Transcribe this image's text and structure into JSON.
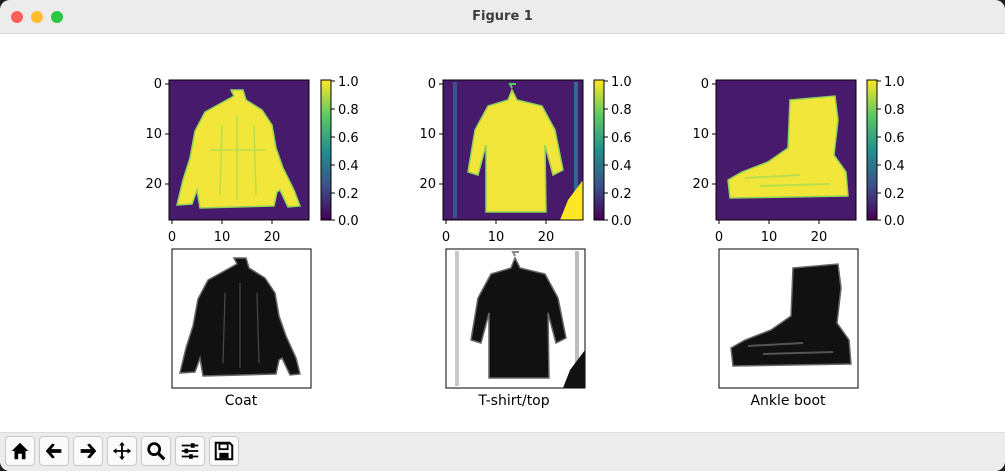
{
  "window": {
    "title": "Figure 1"
  },
  "figure": {
    "heatmaps": [
      {
        "name": "coat",
        "xticks": [
          "0",
          "10",
          "20"
        ],
        "yticks": [
          "0",
          "10",
          "20"
        ],
        "colorbar_ticks": [
          "1.0",
          "0.8",
          "0.6",
          "0.4",
          "0.2",
          "0.0"
        ]
      },
      {
        "name": "tshirt",
        "xticks": [
          "0",
          "10",
          "20"
        ],
        "yticks": [
          "0",
          "10",
          "20"
        ],
        "colorbar_ticks": [
          "1.0",
          "0.8",
          "0.6",
          "0.4",
          "0.2",
          "0.0"
        ]
      },
      {
        "name": "boot",
        "xticks": [
          "0",
          "10",
          "20"
        ],
        "yticks": [
          "0",
          "10",
          "20"
        ],
        "colorbar_ticks": [
          "1.0",
          "0.8",
          "0.6",
          "0.4",
          "0.2",
          "0.0"
        ]
      }
    ],
    "captions": [
      "Coat",
      "T-shirt/top",
      "Ankle boot"
    ]
  },
  "toolbar": {
    "buttons": [
      "home-icon",
      "back-arrow-icon",
      "forward-arrow-icon",
      "pan-icon",
      "zoom-icon",
      "subplots-icon",
      "save-icon"
    ]
  },
  "colors": {
    "viridis_low": "#440154",
    "viridis_high": "#fde725",
    "background": "#ffffff"
  }
}
